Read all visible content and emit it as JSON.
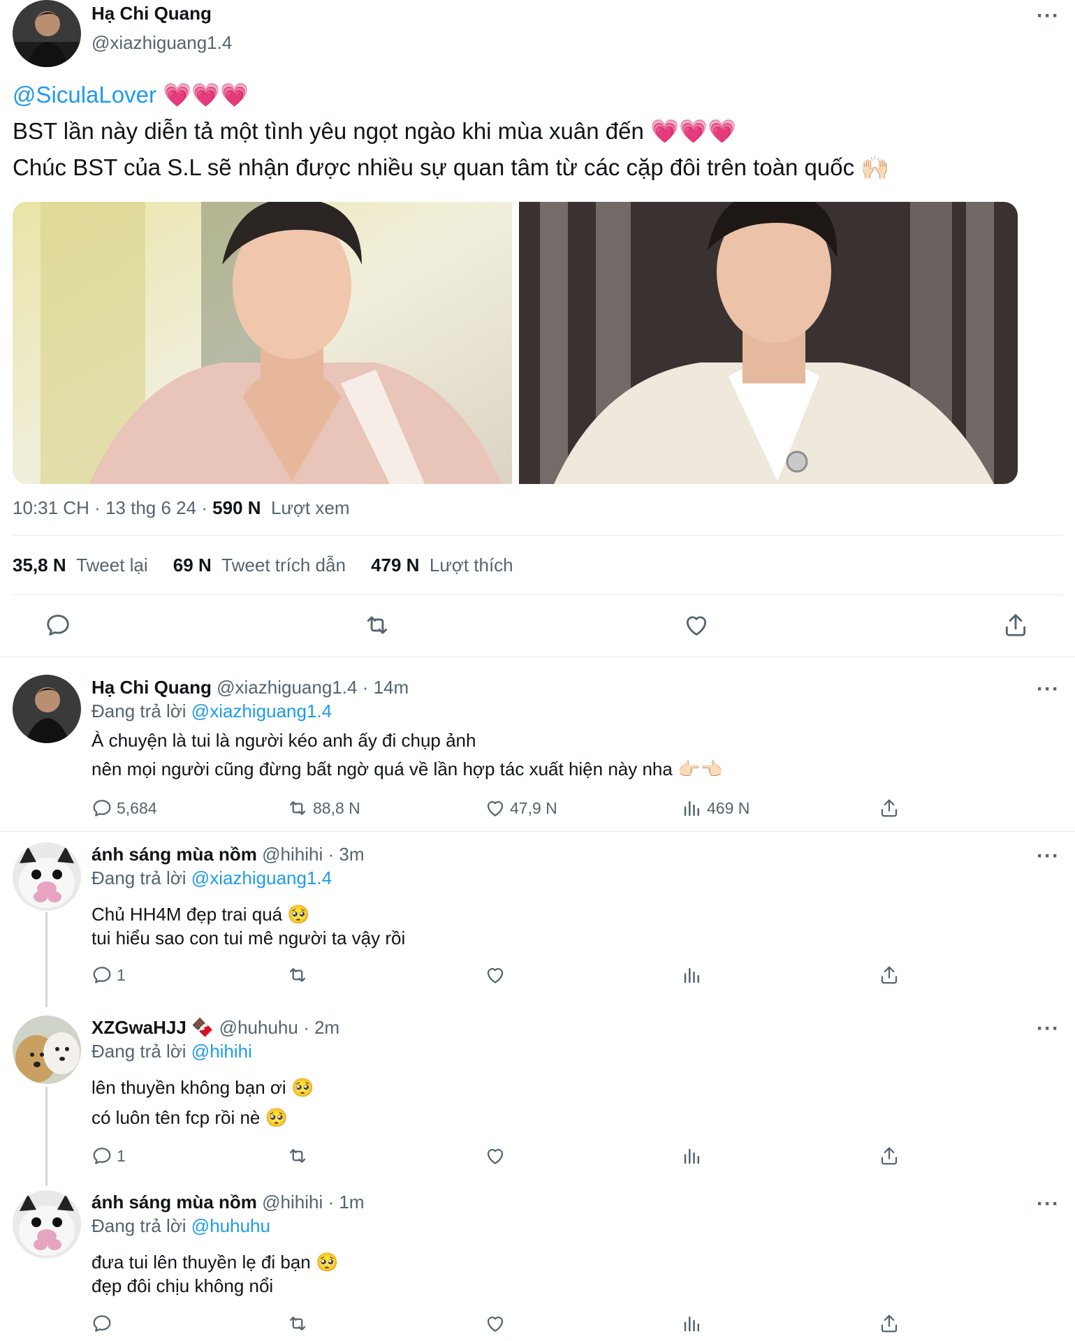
{
  "main_tweet": {
    "author_name": "Hạ Chi Quang",
    "handle": "@xiazhiguang1.4",
    "mention": "@SiculaLover",
    "mention_emoji": "💗💗💗",
    "line2": "BST lần này diễn tả một tình yêu ngọt ngào khi mùa xuân đến",
    "line2_emoji": "💗💗💗",
    "line3": "Chúc BST của S.L sẽ nhận được nhiều sự quan tâm từ các cặp đôi trên toàn quốc",
    "line3_emoji": "🙌🏻",
    "meta_time": "10:31 CH · 13 thg 6 24 · ",
    "views_count": "590 N",
    "views_label": "Lượt xem",
    "retweets_count": "35,8 N",
    "retweets_label": "Tweet lại",
    "quotes_count": "69 N",
    "quotes_label": "Tweet trích dẫn",
    "likes_count": "479 N",
    "likes_label": "Lượt thích"
  },
  "replies": [
    {
      "name": "Hạ Chi Quang",
      "handle": "@xiazhiguang1.4",
      "time": "· 14m",
      "replying_prefix": "Đang trả lời",
      "replying_to": "@xiazhiguang1.4",
      "line1": "À chuyện là tui là người kéo anh ấy đi chụp ảnh",
      "line2": "nên mọi người cũng đừng bất ngờ quá về lần hợp tác xuất hiện này nha",
      "line2_emoji": "👉🏻👈🏻",
      "replies": "5,684",
      "retweets": "88,8 N",
      "likes": "47,9 N",
      "views": "469 N"
    },
    {
      "name": "ánh sáng mùa nồm",
      "handle": "@hihihi",
      "time": "· 3m",
      "replying_prefix": "Đang trả lời",
      "replying_to": "@xiazhiguang1.4",
      "line1": "Chủ HH4M đẹp trai quá",
      "line1_emoji": "🥺",
      "line2": "tui hiểu sao con tui mê người ta vậy rồi",
      "replies": "1"
    },
    {
      "name": "XZGwaHJJ",
      "name_emoji": "🍫",
      "handle": "@huhuhu",
      "time": "· 2m",
      "replying_prefix": "Đang trả lời",
      "replying_to": "@hihihi",
      "line1": "lên thuyền không bạn ơi",
      "line1_emoji": "🥺",
      "line2": "có luôn tên fcp rồi nè",
      "line2_emoji": "🥺",
      "replies": "1"
    },
    {
      "name": "ánh sáng mùa nồm",
      "handle": "@hihihi",
      "time": "· 1m",
      "replying_prefix": "Đang trả lời",
      "replying_to": "@huhuhu",
      "line1": "đưa tui lên thuyền lẹ đi bạn",
      "line1_emoji": "🥺",
      "line2": "đẹp đôi chịu không nổi"
    }
  ],
  "colors": {
    "link_blue": "#1d9bf0",
    "muted_gray": "#536471",
    "divider": "#e6e9ec"
  }
}
